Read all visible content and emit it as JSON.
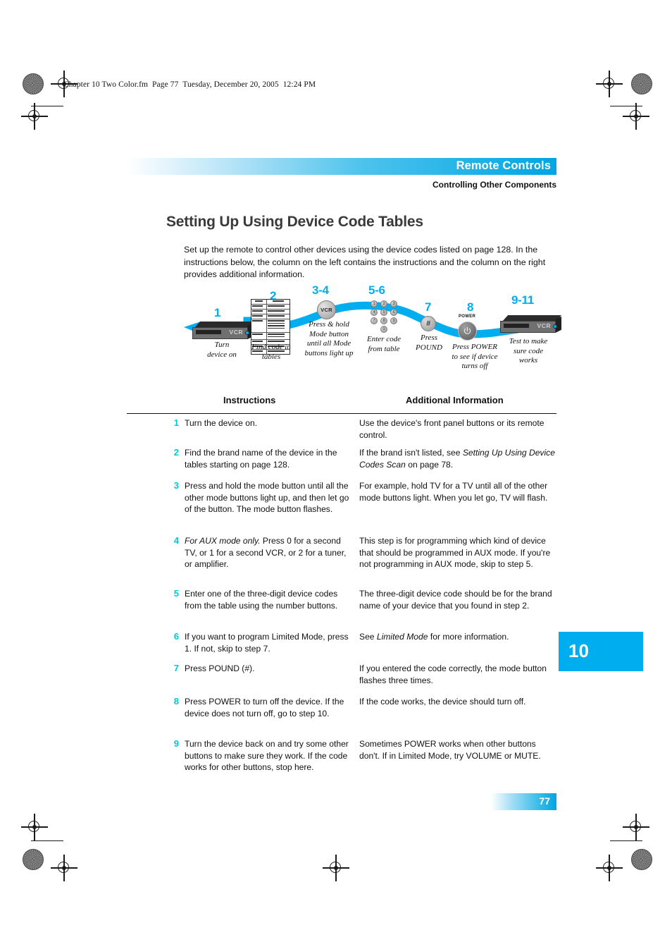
{
  "print_header": "Chapter 10 Two Color.fm  Page 77  Tuesday, December 20, 2005  12:24 PM",
  "header": {
    "band_title": "Remote Controls",
    "subtitle": "Controlling Other Components"
  },
  "section": {
    "title": "Setting Up Using Device Code Tables",
    "intro": "Set up the remote to control other devices using the device codes listed on page 128. In the instructions below, the column on the left contains the instructions and the column on the right provides additional information."
  },
  "flow": {
    "steps": [
      {
        "number": "1",
        "caption": "Turn\ndevice on",
        "icon": "vcr-device-icon"
      },
      {
        "number": "2",
        "caption": "Find code in\ntables",
        "icon": "code-table-icon"
      },
      {
        "number": "3-4",
        "caption": "Press & hold\nMode button\nuntil all Mode\nbuttons light up",
        "icon": "mode-button-icon",
        "button_label": "VCR"
      },
      {
        "number": "5-6",
        "caption": "Enter code\nfrom table",
        "icon": "keypad-icon",
        "keys": [
          [
            "1",
            "2",
            "3"
          ],
          [
            "4",
            "5",
            "6"
          ],
          [
            "7",
            "8",
            "9"
          ],
          [
            "0"
          ]
        ]
      },
      {
        "number": "7",
        "caption": "Press\nPOUND",
        "icon": "pound-button-icon",
        "button_label": "#"
      },
      {
        "number": "8",
        "caption": "Press POWER\nto see if device\nturns off",
        "icon": "power-button-icon",
        "button_label": "POWER"
      },
      {
        "number": "9-11",
        "caption": "Test to make\nsure code\nworks",
        "icon": "vcr-device-icon"
      }
    ]
  },
  "table": {
    "headers": {
      "instructions": "Instructions",
      "additional": "Additional Information"
    },
    "rows": [
      {
        "num": "1",
        "instruction": "Turn the device on.",
        "additional": "Use the device's front panel buttons or its remote control."
      },
      {
        "num": "2",
        "instruction": "Find the brand name of the device in the tables starting on page 128.",
        "additional_pre": "If the brand isn't listed, see ",
        "additional_em": "Setting Up Using Device Codes Scan",
        "additional_post": " on page 78."
      },
      {
        "num": "3",
        "instruction": "Press and hold the mode button until all the other mode buttons light up, and then let go of the button. The mode button flashes.",
        "additional": "For example, hold TV for a TV until all of the other mode buttons light. When you let go, TV will flash."
      },
      {
        "num": "4",
        "instruction_em": "For AUX mode only.",
        "instruction_post": " Press 0 for a second TV, or 1 for a second VCR, or 2 for a tuner, or amplifier.",
        "additional": "This step is for programming which kind of device that should be programmed in AUX mode. If you're not programming in AUX mode, skip to step 5."
      },
      {
        "num": "5",
        "instruction": "Enter one of the three-digit device codes from the table using the number buttons.",
        "additional": "The three-digit device code should be for the brand name of your device that you found in step 2."
      },
      {
        "num": "6",
        "instruction": "If you want to program Limited Mode, press 1. If not, skip to step 7.",
        "additional_pre": "See ",
        "additional_em": "Limited Mode",
        "additional_post": " for more information."
      },
      {
        "num": "7",
        "instruction": "Press POUND (#).",
        "additional": "If you entered the code correctly, the mode button flashes three times."
      },
      {
        "num": "8",
        "instruction": "Press POWER to turn off the device. If the device does not turn off, go to step 10.",
        "additional": "If the code works, the device should turn off."
      },
      {
        "num": "9",
        "instruction": "Turn the device back on and try some other buttons to make sure they work. If the code works for other buttons, stop here.",
        "additional": "Sometimes POWER works when other buttons don't. If in Limited Mode, try VOLUME or MUTE."
      }
    ]
  },
  "chapter_tab": "10",
  "page_number": "77",
  "colors": {
    "accent_cyan": "#00AEEF",
    "step_number_cyan": "#00C8D4",
    "band_end": "#00a5e3"
  }
}
